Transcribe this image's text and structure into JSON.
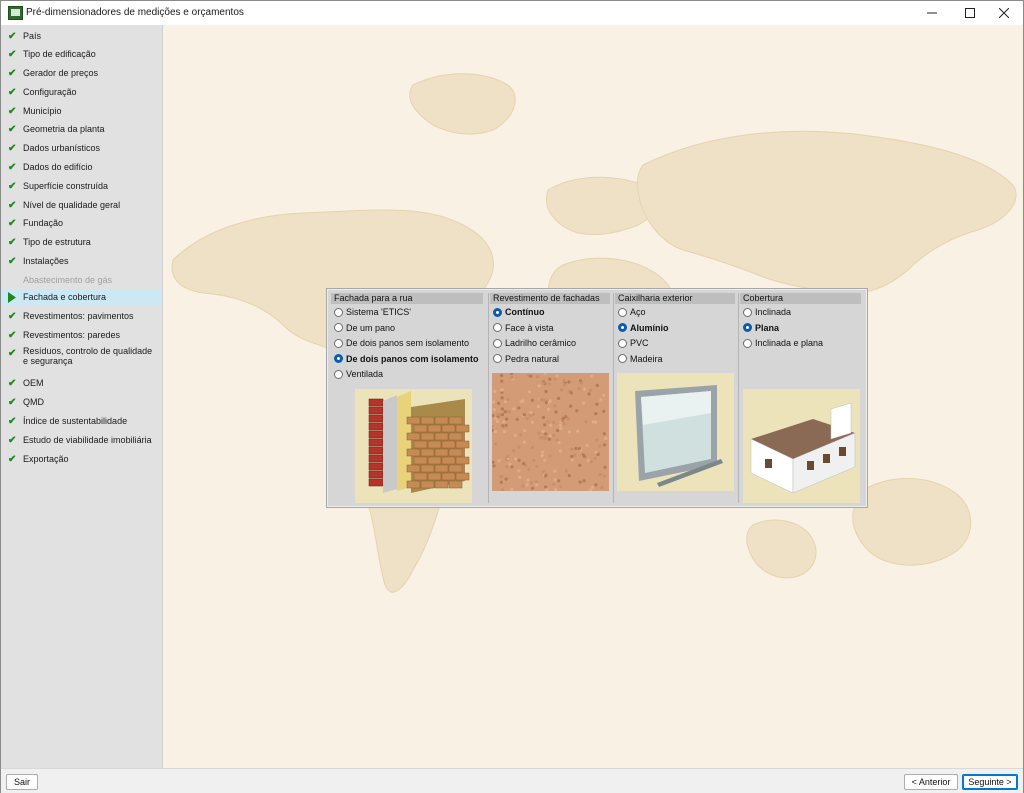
{
  "window": {
    "title": "Pré-dimensionadores de medições e orçamentos",
    "minimize_icon": "minimize-icon",
    "maximize_icon": "maximize-icon",
    "close_icon": "close-icon"
  },
  "sidebar": {
    "items": [
      {
        "label": "País",
        "state": "done"
      },
      {
        "label": "Tipo de edificação",
        "state": "done"
      },
      {
        "label": "Gerador de preços",
        "state": "done"
      },
      {
        "label": "Configuração",
        "state": "done"
      },
      {
        "label": "Município",
        "state": "done"
      },
      {
        "label": "Geometria da planta",
        "state": "done"
      },
      {
        "label": "Dados urbanísticos",
        "state": "done"
      },
      {
        "label": "Dados do edifício",
        "state": "done"
      },
      {
        "label": "Superfície construída",
        "state": "done"
      },
      {
        "label": "Nível de qualidade geral",
        "state": "done"
      },
      {
        "label": "Fundação",
        "state": "done"
      },
      {
        "label": "Tipo de estrutura",
        "state": "done"
      },
      {
        "label": "Instalações",
        "state": "done"
      },
      {
        "label": "Abastecimento de gás",
        "state": "disabled"
      },
      {
        "label": "Fachada e cobertura",
        "state": "current"
      },
      {
        "label": "Revestimentos: pavimentos",
        "state": "done"
      },
      {
        "label": "Revestimentos: paredes",
        "state": "done"
      },
      {
        "label": "Resíduos, controlo de qualidade e segurança",
        "state": "done"
      },
      {
        "label": "OEM",
        "state": "done"
      },
      {
        "label": "QMD",
        "state": "done"
      },
      {
        "label": "Índice de sustentabilidade",
        "state": "done"
      },
      {
        "label": "Estudo de viabilidade imobiliária",
        "state": "done"
      },
      {
        "label": "Exportação",
        "state": "done"
      }
    ]
  },
  "panel": {
    "columns": [
      {
        "header": "Fachada para a rua",
        "options": [
          {
            "label": "Sistema 'ETICS'",
            "selected": false
          },
          {
            "label": "De um pano",
            "selected": false
          },
          {
            "label": "De dois panos sem isolamento",
            "selected": false
          },
          {
            "label": "De dois panos com isolamento",
            "selected": true
          },
          {
            "label": "Ventilada",
            "selected": false
          }
        ],
        "image": "brick-wall-insulation-illustration"
      },
      {
        "header": "Revestimento de fachadas",
        "options": [
          {
            "label": "Contínuo",
            "selected": true
          },
          {
            "label": "Face à vista",
            "selected": false
          },
          {
            "label": "Ladrilho cerâmico",
            "selected": false
          },
          {
            "label": "Pedra natural",
            "selected": false
          }
        ],
        "image": "stucco-texture-illustration"
      },
      {
        "header": "Caixilharia exterior",
        "options": [
          {
            "label": "Aço",
            "selected": false
          },
          {
            "label": "Alumínio",
            "selected": true
          },
          {
            "label": "PVC",
            "selected": false
          },
          {
            "label": "Madeira",
            "selected": false
          }
        ],
        "image": "aluminium-window-illustration"
      },
      {
        "header": "Cobertura",
        "options": [
          {
            "label": "Inclinada",
            "selected": false
          },
          {
            "label": "Plana",
            "selected": true
          },
          {
            "label": "Inclinada e plana",
            "selected": false
          }
        ],
        "image": "flat-roof-house-illustration"
      }
    ]
  },
  "footer": {
    "exit_label": "Sair",
    "previous_label": "< Anterior",
    "next_label": "Seguinte >"
  },
  "colors": {
    "accent": "#0b5cad",
    "check": "#1e8a1e",
    "current_item": "#cce8f4",
    "map_background": "#f8f1e4"
  }
}
